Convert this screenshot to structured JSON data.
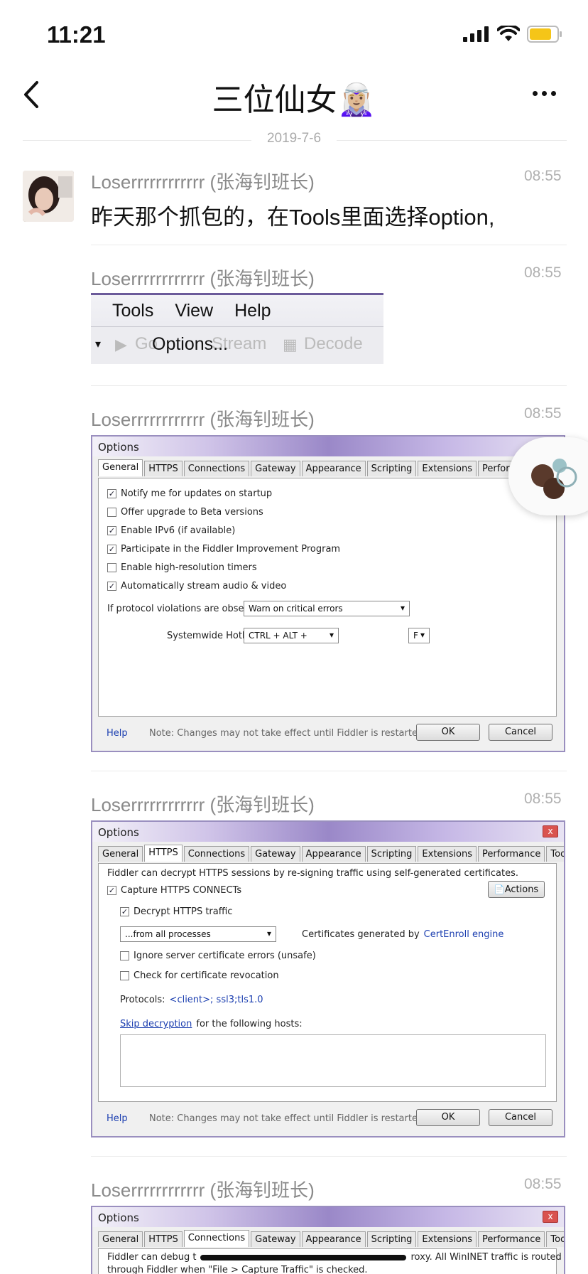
{
  "status_bar": {
    "time": "11:21"
  },
  "nav": {
    "title": "三位仙女",
    "title_emoji": "🧝🏼‍♀️"
  },
  "date": "2019-7-6",
  "messages": [
    {
      "sender": "Loserrrrrrrrrrrr (张海钊班长)",
      "time": "08:55",
      "text": "昨天那个抓包的，在Tools里面选择option,"
    },
    {
      "sender": "Loserrrrrrrrrrrr (张海钊班长)",
      "time": "08:55"
    },
    {
      "sender": "Loserrrrrrrrrrrr (张海钊班长)",
      "time": "08:55"
    },
    {
      "sender": "Loserrrrrrrrrrrr (张海钊班长)",
      "time": "08:55"
    },
    {
      "sender": "Loserrrrrrrrrrrr (张海钊班长)",
      "time": "08:55"
    }
  ],
  "menu_image": {
    "menu": [
      "Tools",
      "View",
      "Help"
    ],
    "toolbar": {
      "go": "Go",
      "options": "Options...",
      "stream": "Stream",
      "decode": "Decode"
    }
  },
  "options_general": {
    "title": "Options",
    "tabs": [
      "General",
      "HTTPS",
      "Connections",
      "Gateway",
      "Appearance",
      "Scripting",
      "Extensions",
      "Performance"
    ],
    "checks": [
      {
        "label": "Notify me for updates on startup",
        "checked": true
      },
      {
        "label": "Offer upgrade to Beta versions",
        "checked": false
      },
      {
        "label": "Enable IPv6 (if available)",
        "checked": true
      },
      {
        "label": "Participate in the Fiddler Improvement Program",
        "checked": true
      },
      {
        "label": "Enable high-resolution timers",
        "checked": false
      },
      {
        "label": "Automatically stream audio & video",
        "checked": true
      }
    ],
    "protocol_label": "If protocol violations are observed:",
    "protocol_value": "Warn on critical errors",
    "hotkey_label": "Systemwide Hotkey:",
    "hotkey_value": "CTRL + ALT +",
    "hotkey_key": "F",
    "help": "Help",
    "note": "Note: Changes may not take effect until Fiddler is restarted.",
    "ok": "OK",
    "cancel": "Cancel"
  },
  "options_https": {
    "title": "Options",
    "close": "x",
    "tabs": [
      "General",
      "HTTPS",
      "Connections",
      "Gateway",
      "Appearance",
      "Scripting",
      "Extensions",
      "Performance",
      "Tools"
    ],
    "intro": "Fiddler can decrypt HTTPS sessions by re-signing traffic using self-generated certificates.",
    "capture": "Capture HTTPS CONNECTs",
    "actions": "Actions",
    "decrypt": "Decrypt HTTPS traffic",
    "from_value": "...from all processes",
    "cert_prefix": "Certificates generated by ",
    "cert_link": "CertEnroll engine",
    "ignore": "Ignore server certificate errors (unsafe)",
    "revocation": "Check for certificate revocation",
    "protocols_label": "Protocols: ",
    "protocols_value": "<client>; ssl3;tls1.0",
    "skip_link": "Skip decryption",
    "skip_rest": " for the following hosts:",
    "help": "Help",
    "note": "Note: Changes may not take effect until Fiddler is restarted.",
    "ok": "OK",
    "cancel": "Cancel"
  },
  "options_connections": {
    "title": "Options",
    "close": "x",
    "tabs": [
      "General",
      "HTTPS",
      "Connections",
      "Gateway",
      "Appearance",
      "Scripting",
      "Extensions",
      "Performance",
      "Tools"
    ],
    "line1_start": "Fiddler can debug t",
    "line1_end": "roxy. All WinINET traffic is routed",
    "line2": "through Fiddler when \"File > Capture Traffic\" is checked."
  }
}
